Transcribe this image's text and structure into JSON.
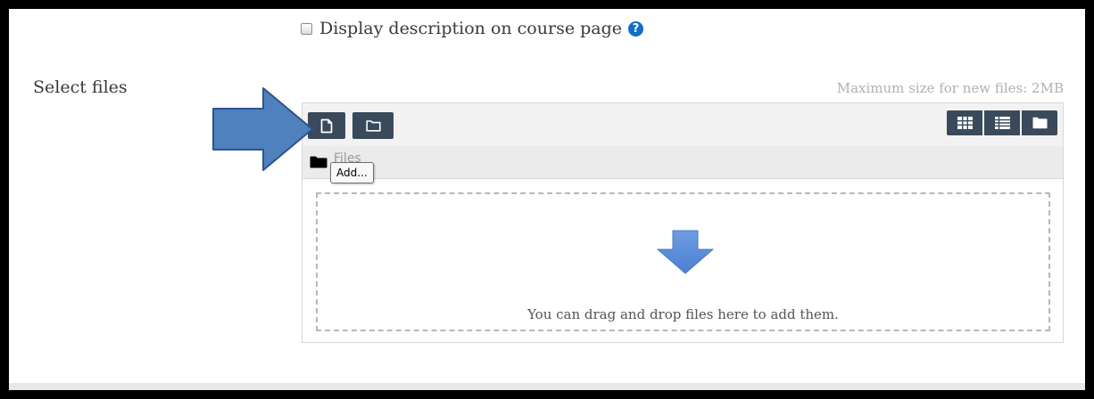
{
  "form": {
    "display_description_label": "Display description on course page",
    "display_description_checked": false,
    "help_icon_glyph": "?",
    "select_files_label": "Select files",
    "max_size_text": "Maximum size for new files: 2MB"
  },
  "file_picker": {
    "toolbar": {
      "add_icon": "file-icon",
      "create_folder_icon": "folder-outline-icon",
      "view_icons": [
        "grid-icon",
        "list-icon",
        "folder-icon"
      ]
    },
    "path": {
      "label": "Files",
      "icon": "folder-icon"
    },
    "tooltip_text": "Add...",
    "dropzone_text": "You can drag and drop files here to add them."
  },
  "colors": {
    "button_bg": "#3a4a5b",
    "help_icon": "#0f6fc5",
    "callout_arrow": "#4f81bd",
    "drop_arrow": "#5b8bd6"
  }
}
